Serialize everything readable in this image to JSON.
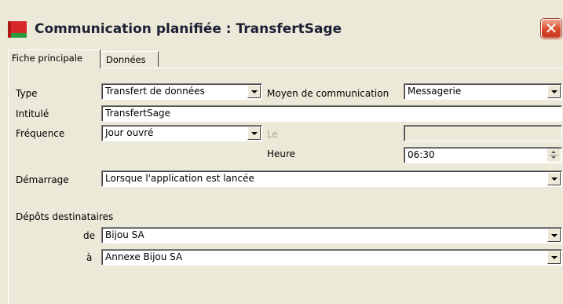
{
  "window": {
    "title": "Communication planifiée : TransfertSage",
    "close_glyph": "✕"
  },
  "tabs": [
    {
      "label": "Fiche principale",
      "active": true
    },
    {
      "label": "Données",
      "active": false
    }
  ],
  "form": {
    "type": {
      "label": "Type",
      "value": "Transfert de données"
    },
    "moyen": {
      "label": "Moyen de communication",
      "value": "Messagerie"
    },
    "intitule": {
      "label": "Intitulé",
      "value": "TransfertSage"
    },
    "frequence": {
      "label": "Fréquence",
      "value": "Jour ouvré"
    },
    "le": {
      "label": "Le",
      "value": ""
    },
    "heure": {
      "label": "Heure",
      "value": "06:30"
    },
    "demarrage": {
      "label": "Démarrage",
      "value": "Lorsque l'application est lancée"
    },
    "depots": {
      "section_label": "Dépôts destinataires",
      "de": {
        "label": "de",
        "value": "Bijou SA"
      },
      "a": {
        "label": "à",
        "value": "Annexe Bijou SA"
      }
    }
  },
  "colors": {
    "window_bg": "#ece9d8",
    "close_red": "#d8482a",
    "icon_red": "#d8282a",
    "icon_green": "#2a9a3a"
  },
  "icons": [
    "app-icon",
    "close-icon",
    "chevron-down-icon",
    "spin-icon"
  ]
}
